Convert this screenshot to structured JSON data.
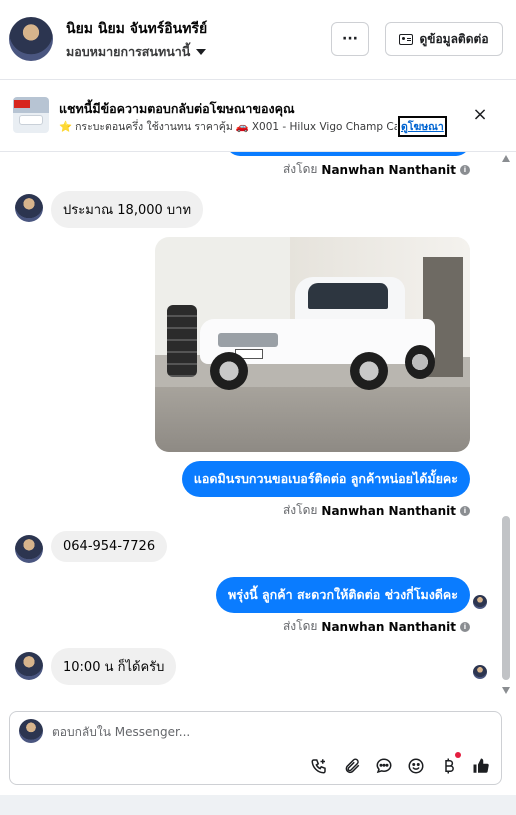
{
  "header": {
    "name": "นิยม นิยม จันทร์อินทรีย์",
    "label": "มอบหมายการสนทนานี้",
    "more_label": "···",
    "contact_button": "ดูข้อมูลติดต่อ"
  },
  "ad_banner": {
    "title": "แชทนี้มีข้อความตอบกลับต่อโฆษณาของคุณ",
    "subtitle_star": "⭐",
    "subtitle_text_1": "กระบะตอนครึ่ง ใช้งานทน ราคาคุ้ม",
    "subtitle_car": "🚗",
    "subtitle_text_2": "X001 - Hilux Vigo Champ Cab...",
    "link": "ดูโฆษณา",
    "close": "×"
  },
  "messages": [
    {
      "type": "sent_by",
      "prefix": "ส่งโดย",
      "sender": "Nanwhan Nanthanit"
    },
    {
      "type": "incoming",
      "text": "ประมาณ 18,000 บาท"
    },
    {
      "type": "outgoing_image",
      "alt": "white pickup truck photo"
    },
    {
      "type": "outgoing",
      "text": "แอดมินรบกวนขอเบอร์ติดต่อ ลูกค้าหน่อยได้มั้ยคะ"
    },
    {
      "type": "sent_by",
      "prefix": "ส่งโดย",
      "sender": "Nanwhan Nanthanit"
    },
    {
      "type": "incoming",
      "text": "064-954-7726"
    },
    {
      "type": "outgoing",
      "text": "พรุ่งนี้ ลูกค้า สะดวกให้ติดต่อ ช่วงกี่โมงดีคะ"
    },
    {
      "type": "sent_by",
      "prefix": "ส่งโดย",
      "sender": "Nanwhan Nanthanit"
    },
    {
      "type": "incoming",
      "text": "10:00 น ก็ได้ครับ"
    }
  ],
  "composer": {
    "placeholder": "ตอบกลับใน Messenger...",
    "tools": [
      "call-add-icon",
      "paperclip-icon",
      "chat-bubble-icon",
      "emoji-icon",
      "baht-icon",
      "thumbs-up-icon"
    ]
  },
  "colors": {
    "outgoing_bubble": "#0a7cff",
    "incoming_bubble": "#f0f0f0",
    "link": "#0064d1"
  }
}
